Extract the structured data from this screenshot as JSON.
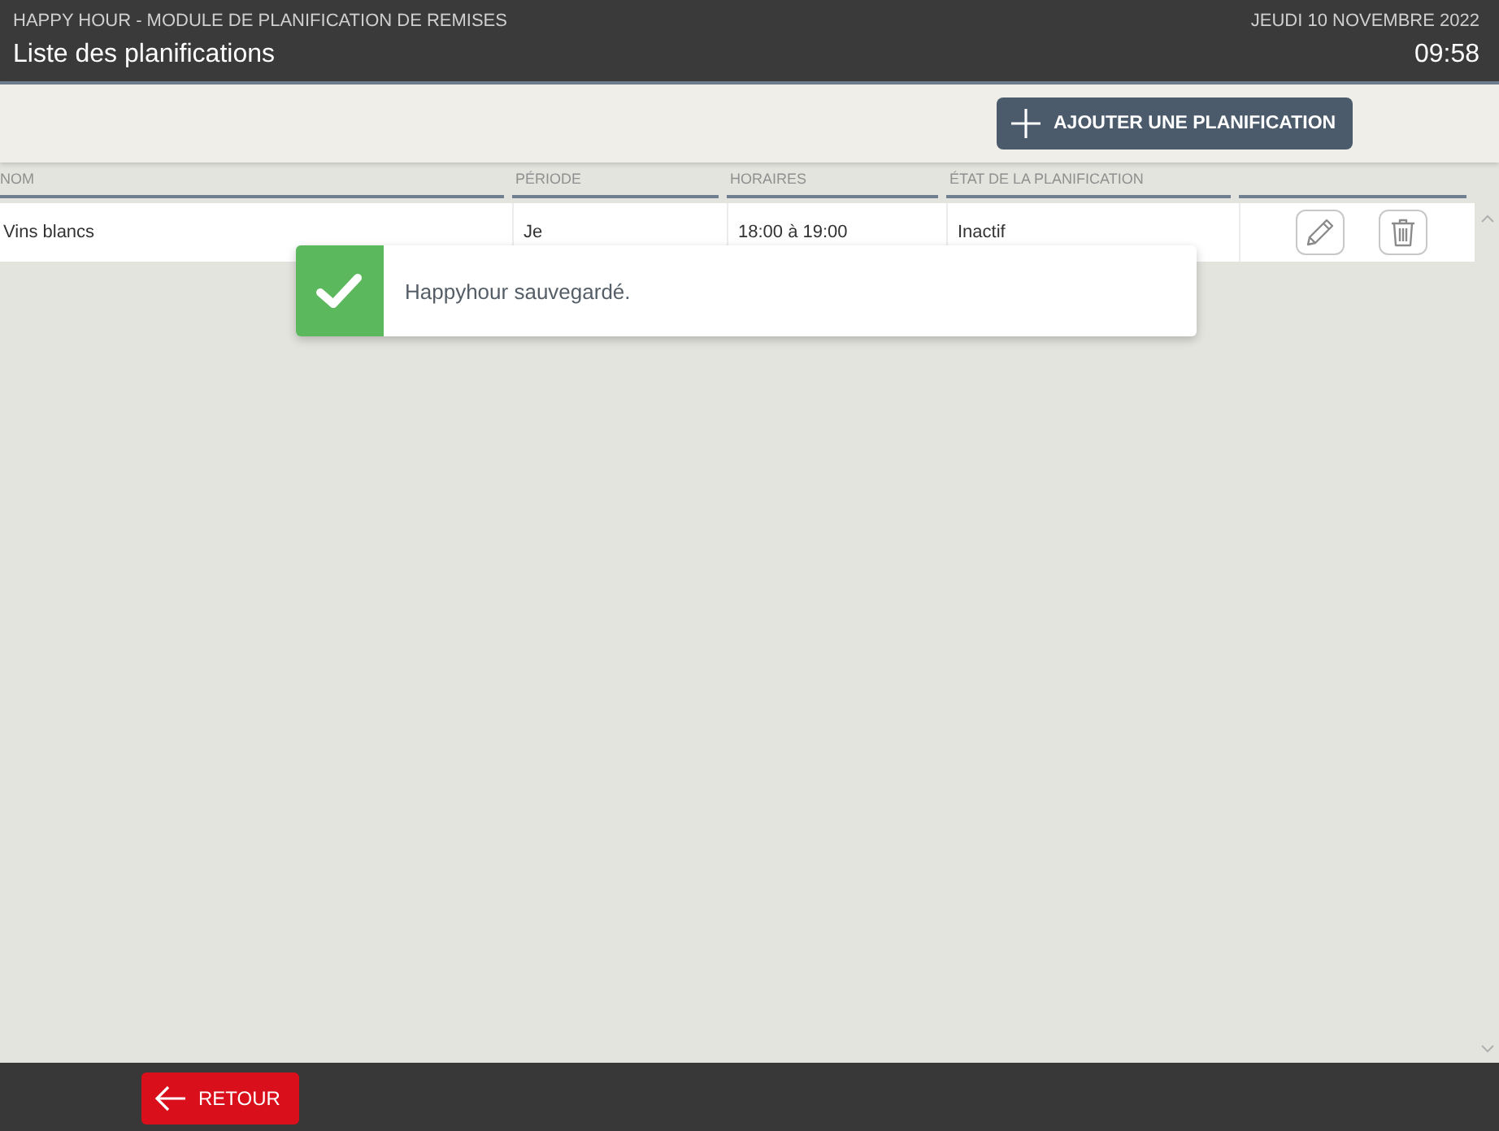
{
  "header": {
    "module_title": "HAPPY HOUR - MODULE DE PLANIFICATION DE REMISES",
    "page_title": "Liste des planifications",
    "date": "JEUDI 10 NOVEMBRE 2022",
    "time": "09:58"
  },
  "toolbar": {
    "add_button": "AJOUTER UNE PLANIFICATION"
  },
  "table": {
    "columns": [
      "NOM",
      "PÉRIODE",
      "HORAIRES",
      "ÉTAT DE LA PLANIFICATION"
    ],
    "rows": [
      {
        "cells": [
          "Vins blancs",
          "Je",
          "18:00 à 19:00",
          "Inactif"
        ]
      }
    ]
  },
  "toast": {
    "kind": "success",
    "message": "Happyhour sauvegardé."
  },
  "footer": {
    "back_button": "RETOUR"
  }
}
